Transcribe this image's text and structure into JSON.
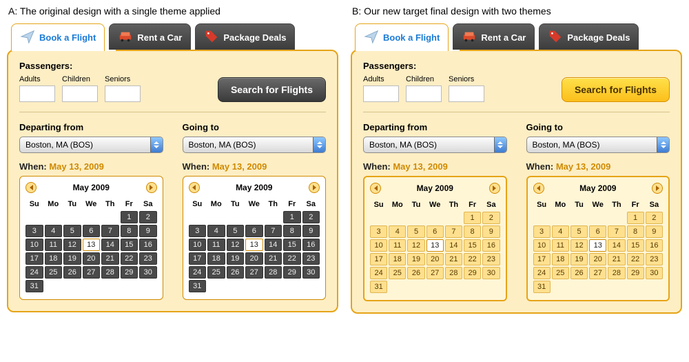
{
  "captions": {
    "a": "A: The original design with a single theme applied",
    "b": "B: Our new target final design with two themes"
  },
  "tabs": [
    {
      "label": "Book a Flight",
      "icon": "paper-plane-icon",
      "active": true
    },
    {
      "label": "Rent a Car",
      "icon": "car-icon",
      "active": false
    },
    {
      "label": "Package Deals",
      "icon": "tag-icon",
      "active": false
    }
  ],
  "passengers": {
    "title": "Passengers:",
    "fields": [
      {
        "key": "adults",
        "label": "Adults"
      },
      {
        "key": "children",
        "label": "Children"
      },
      {
        "key": "seniors",
        "label": "Seniors"
      }
    ]
  },
  "searchLabel": "Search for Flights",
  "locations": {
    "depart": {
      "heading": "Departing from",
      "selected": "Boston, MA (BOS)"
    },
    "going": {
      "heading": "Going to",
      "selected": "Boston, MA (BOS)"
    }
  },
  "when": {
    "label": "When:",
    "date": "May 13, 2009"
  },
  "calendar": {
    "title": "May 2009",
    "weekdays": [
      "Su",
      "Mo",
      "Tu",
      "We",
      "Th",
      "Fr",
      "Sa"
    ],
    "firstDayIndex": 5,
    "daysInMonth": 31,
    "selectedDay": 13
  }
}
